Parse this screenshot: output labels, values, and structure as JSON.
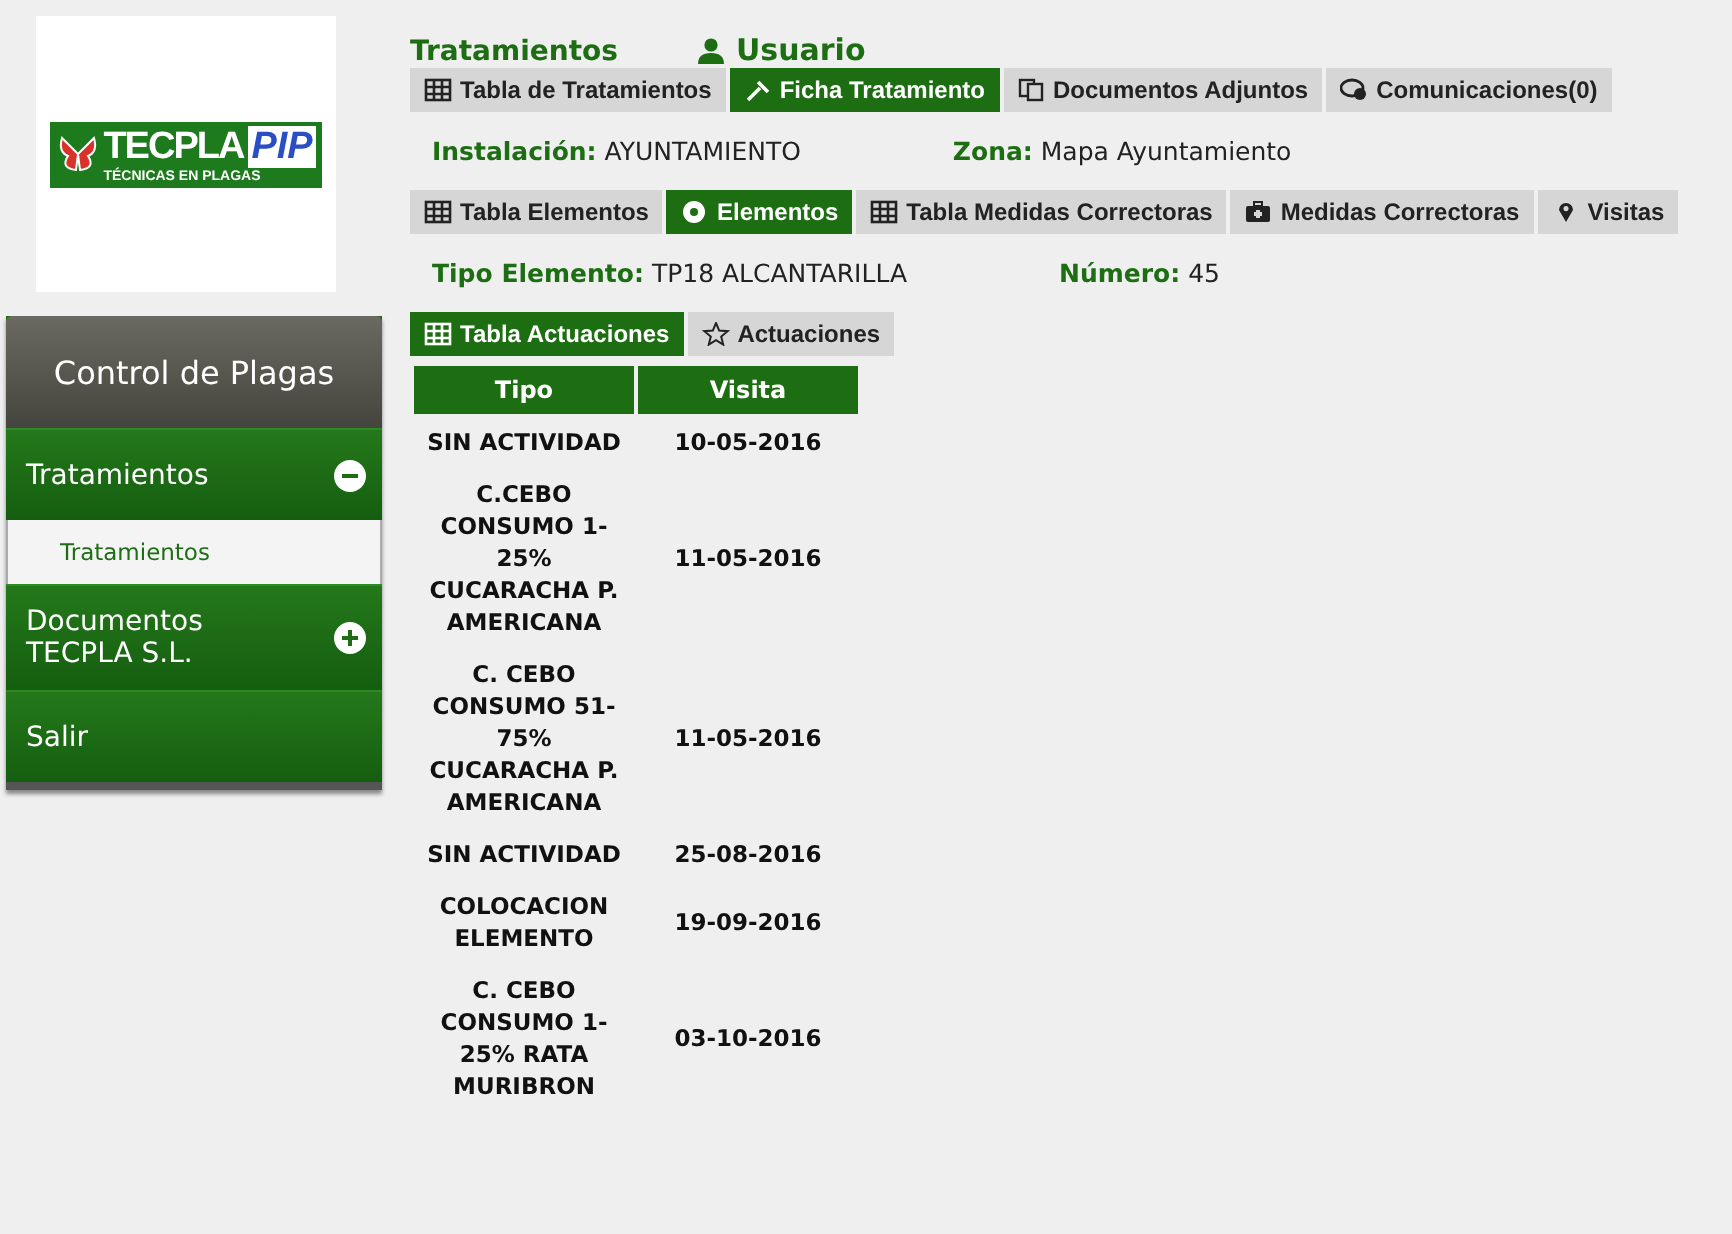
{
  "logo": {
    "word_a": "TECPLA",
    "word_b": "PIP",
    "tagline": "TÉCNICAS EN PLAGAS"
  },
  "sidebar": {
    "title": "Control de Plagas",
    "items": [
      {
        "label": "Tratamientos",
        "kind": "group",
        "expanded": true,
        "children": [
          {
            "label": "Tratamientos"
          }
        ]
      },
      {
        "label": "Documentos TECPLA S.L.",
        "kind": "group",
        "expanded": false
      },
      {
        "label": "Salir",
        "kind": "link"
      }
    ]
  },
  "header": {
    "title": "Tratamientos",
    "user": "Usuario"
  },
  "tabs": [
    {
      "label": "Tabla de Tratamientos",
      "selected": false
    },
    {
      "label": "Ficha Tratamiento",
      "selected": true
    },
    {
      "label": "Documentos Adjuntos",
      "selected": false
    },
    {
      "label": "Comunicaciones(0)",
      "selected": false
    }
  ],
  "fields": [
    {
      "label": "Instalación:",
      "value": "AYUNTAMIENTO"
    },
    {
      "label": "Zona:",
      "value": "Mapa Ayuntamiento"
    }
  ],
  "element_tabs": [
    {
      "label": "Tabla Elementos",
      "selected": false
    },
    {
      "label": "Elementos",
      "selected": true
    },
    {
      "label": "Tabla Medidas Correctoras",
      "selected": false
    },
    {
      "label": "Medidas Correctoras",
      "selected": false
    },
    {
      "label": "Visitas",
      "selected": false
    }
  ],
  "element_fields": [
    {
      "label": "Tipo Elemento:",
      "value": "TP18 ALCANTARILLA"
    },
    {
      "label": "Número:",
      "value": "45"
    }
  ],
  "action_tabs": [
    {
      "label": "Tabla Actuaciones",
      "selected": true
    },
    {
      "label": "Actuaciones",
      "selected": false
    }
  ],
  "table": {
    "columns": [
      "Tipo",
      "Visita"
    ],
    "rows": [
      [
        "SIN ACTIVIDAD",
        "10-05-2016"
      ],
      [
        "C.CEBO CONSUMO 1-25% CUCARACHA P. AMERICANA",
        "11-05-2016"
      ],
      [
        "C. CEBO CONSUMO 51-75% CUCARACHA P. AMERICANA",
        "11-05-2016"
      ],
      [
        "SIN ACTIVIDAD",
        "25-08-2016"
      ],
      [
        "COLOCACION ELEMENTO",
        "19-09-2016"
      ],
      [
        "C. CEBO CONSUMO 1-25% RATA MURIBRON",
        "03-10-2016"
      ]
    ]
  }
}
